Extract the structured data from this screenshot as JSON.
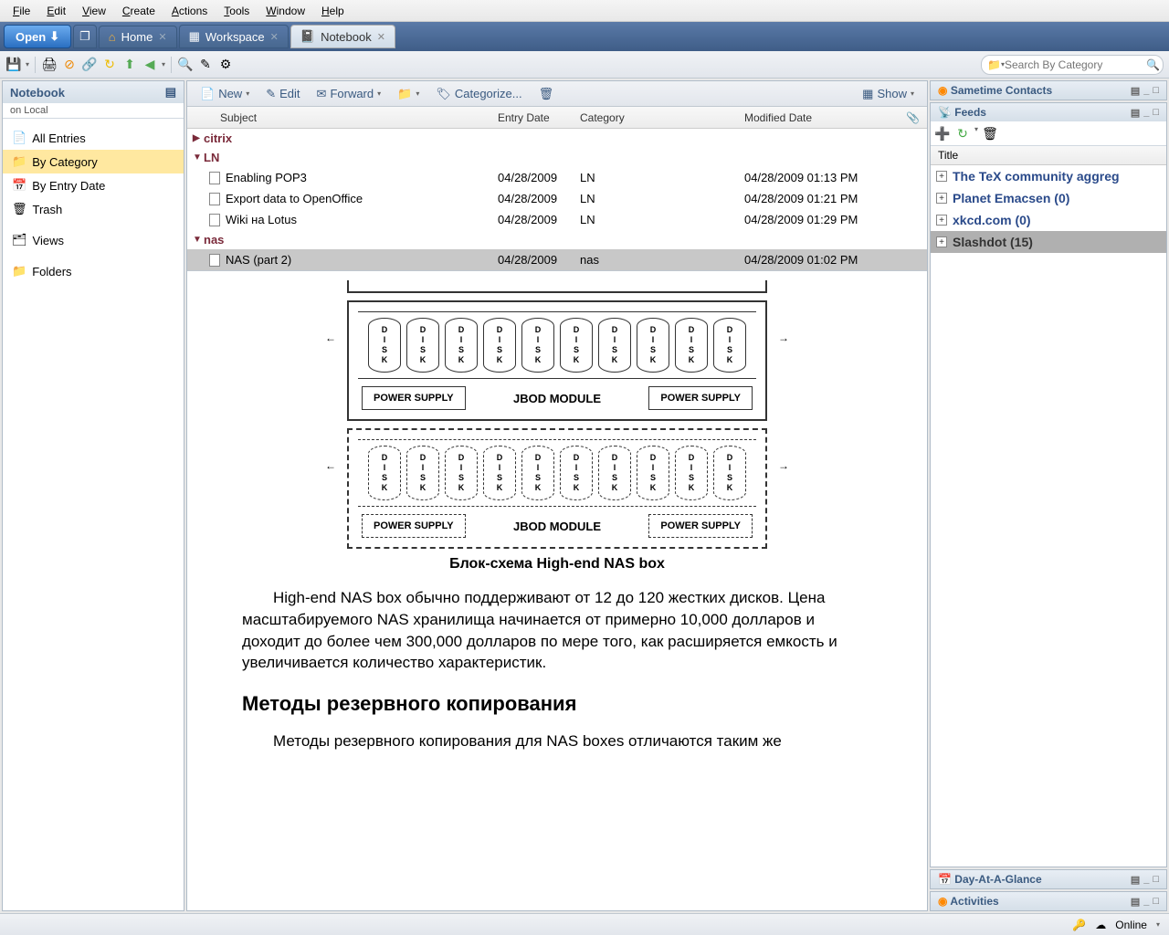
{
  "menu": {
    "items": [
      "File",
      "Edit",
      "View",
      "Create",
      "Actions",
      "Tools",
      "Window",
      "Help"
    ]
  },
  "tabs": {
    "open_label": "Open",
    "items": [
      {
        "label": "Home",
        "active": false
      },
      {
        "label": "Workspace",
        "active": false
      },
      {
        "label": "Notebook",
        "active": true
      }
    ]
  },
  "search": {
    "placeholder": "Search By Category"
  },
  "notebook_panel": {
    "title": "Notebook",
    "subtitle": "on Local",
    "nav": [
      {
        "label": "All Entries",
        "icon": "📄"
      },
      {
        "label": "By Category",
        "icon": "📁",
        "selected": true
      },
      {
        "label": "By Entry Date",
        "icon": "📅"
      },
      {
        "label": "Trash",
        "icon": "🗑"
      }
    ],
    "views_label": "Views",
    "folders_label": "Folders"
  },
  "actions": {
    "new": "New",
    "edit": "Edit",
    "forward": "Forward",
    "categorize": "Categorize...",
    "show": "Show"
  },
  "grid": {
    "headers": {
      "subject": "Subject",
      "entry_date": "Entry Date",
      "category": "Category",
      "modified": "Modified Date"
    },
    "categories": [
      {
        "name": "citrix",
        "expanded": false,
        "rows": []
      },
      {
        "name": "LN",
        "expanded": true,
        "rows": [
          {
            "subject": "Enabling POP3",
            "entry": "04/28/2009",
            "cat": "LN",
            "mod": "04/28/2009 01:13 PM"
          },
          {
            "subject": "Export data to OpenOffice",
            "entry": "04/28/2009",
            "cat": "LN",
            "mod": "04/28/2009 01:21 PM"
          },
          {
            "subject": "Wiki на Lotus",
            "entry": "04/28/2009",
            "cat": "LN",
            "mod": "04/28/2009 01:29 PM"
          }
        ]
      },
      {
        "name": "nas",
        "expanded": true,
        "rows": [
          {
            "subject": "NAS (part 2)",
            "entry": "04/28/2009",
            "cat": "nas",
            "mod": "04/28/2009 01:02 PM",
            "selected": true
          }
        ]
      }
    ]
  },
  "article": {
    "disk_label": "DISK",
    "ps_label": "POWER SUPPLY",
    "jbod_label": "JBOD MODULE",
    "caption": "Блок-схема High-end NAS box",
    "para1": "High-end NAS box обычно поддерживают от 12 до 120 жестких дисков. Цена масштабируемого NAS хранилища начинается от примерно 10,000 долларов и доходит до более чем 300,000 долларов по мере того, как расширяется емкость и увеличивается количество характеристик.",
    "h2": "Методы резервного копирования",
    "para2": "Методы резервного копирования для NAS boxes отличаются таким же"
  },
  "right": {
    "sametime": "Sametime Contacts",
    "feeds": "Feeds",
    "feed_title_col": "Title",
    "feed_items": [
      {
        "label": "The TeX community aggreg"
      },
      {
        "label": "Planet Emacsen (0)"
      },
      {
        "label": "xkcd.com (0)"
      },
      {
        "label": "Slashdot (15)",
        "selected": true
      }
    ],
    "day_glance": "Day-At-A-Glance",
    "activities": "Activities"
  },
  "status": {
    "online": "Online"
  }
}
